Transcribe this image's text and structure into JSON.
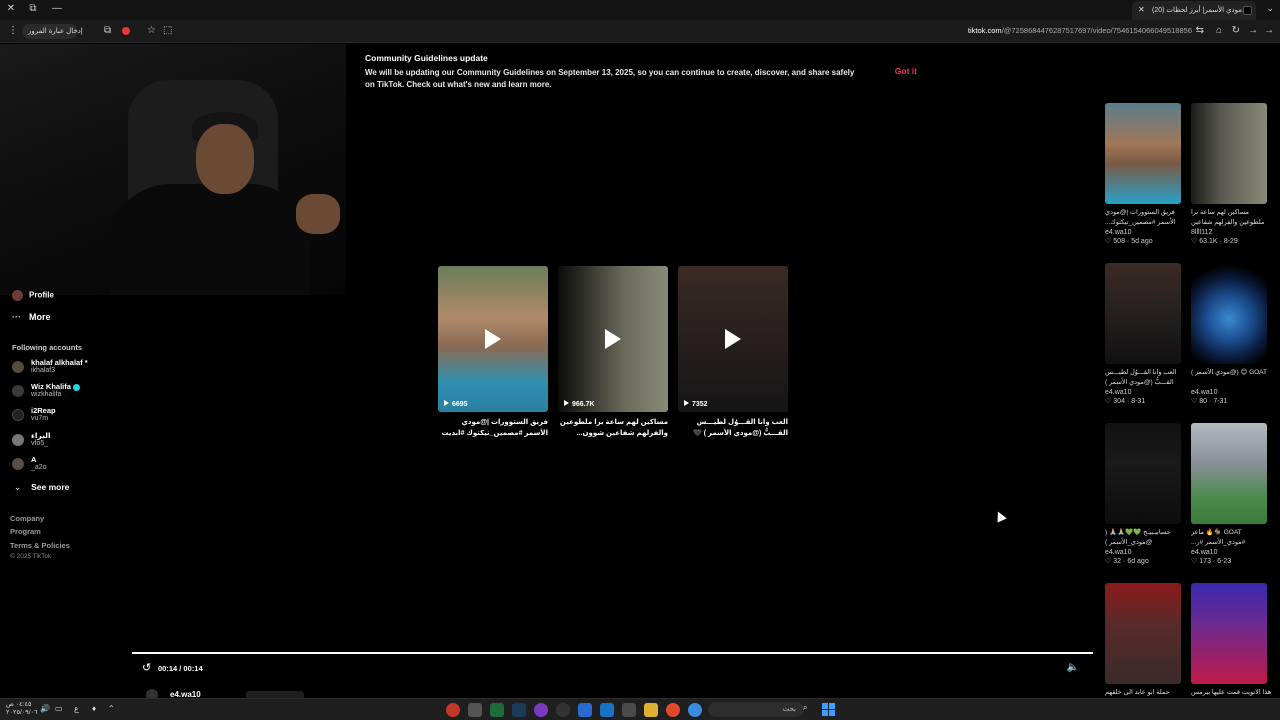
{
  "browser": {
    "tab_title": "(20) مودي الأسمر| أبرز لحظات...",
    "search_pill": "إدخال عبارة المرور",
    "url_host": "tiktok.com",
    "url_path": "/@725868447628751769​7/video/7546154066049518856"
  },
  "banner": {
    "title": "Community Guidelines update",
    "body": "We will be updating our Community Guidelines on September 13, 2025, so you can continue to create, discover, and share safely on TikTok. Check out what's new and learn more.",
    "got_it": "Got it"
  },
  "sidebar": {
    "profile": "Profile",
    "more": "More",
    "following_heading": "Following accounts",
    "accounts": [
      {
        "name": "khalaf alkhalaf *",
        "handle": "ikhalaf3",
        "verified": false
      },
      {
        "name": "Wiz Khalifa",
        "handle": "wizkhalifa",
        "verified": true
      },
      {
        "name": "i2Reap",
        "handle": "vu7m",
        "verified": false
      },
      {
        "name": "البراء",
        "handle": "vfo5_",
        "verified": false
      },
      {
        "name": "A",
        "handle": "_a2o",
        "verified": false
      }
    ],
    "see_more": "See more",
    "footer": [
      "Company",
      "Program",
      "Terms & Policies"
    ],
    "copyright": "© 2025 TikTok"
  },
  "center_videos": [
    {
      "views": "6695",
      "caption": "فريق الستوورات |@مودي الأسمر #مصمين_تيكتوك #ابديت #WR..."
    },
    {
      "views": "966.7K",
      "caption": "مساكين لهم ساعة برا ملطوعين والفرلهم شفاعين شوون..."
    },
    {
      "views": "7352",
      "caption": "العب وانا القـــوُل لطيـــس القـــبُّ (@مودي الأسمر ) 🖤 #مصمين_تيكتوك..."
    }
  ],
  "right_grid": [
    {
      "caption": "فريق الستوورات |@مودي الأسمر #مصمين_تيكتوك...",
      "author": "e4.wa10",
      "likes": "508",
      "date": "5d ago"
    },
    {
      "caption": "مساكين لهم ساعة برا ملطوعين والفرلهم شفاعين شوون",
      "author": "8llll112",
      "likes": "63.1K",
      "date": "8-29"
    },
    {
      "caption": "العب وانا القـــوُل لطيـــس القـــبُّ (@مودي الأسمر )",
      "author": "e4.wa10",
      "likes": "304",
      "date": "8-31"
    },
    {
      "caption": "GOAT 😊 (@مودي الأسمر )",
      "author": "e4.wa10",
      "likes": "80",
      "date": "7-31"
    },
    {
      "caption": "حسابيـييـح 💚💚🙏🏼🙏🏼 ( @مودي_الأسمر ) #مصمين_تيكتوك",
      "author": "e4.wa10",
      "likes": "32",
      "date": "6d ago"
    },
    {
      "caption": "GOAT 🐐🔥 ماعز #مودي_الأسمر #ر...",
      "author": "e4.wa10",
      "likes": "173",
      "date": "6-23"
    },
    {
      "caption": "حملة ابو عابد الى خلقهم",
      "author": "",
      "likes": "",
      "date": ""
    },
    {
      "caption": "هذا الانويت قمت عليها بيرمس",
      "author": "",
      "likes": "",
      "date": ""
    }
  ],
  "player": {
    "time": "00:14 / 00:14",
    "author": "e4.wa10"
  },
  "taskbar": {
    "time": "٠٤:٤٥ ص",
    "date": "٢٠٢٥/٠٩/٠٦",
    "search_placeholder": "بحث"
  }
}
